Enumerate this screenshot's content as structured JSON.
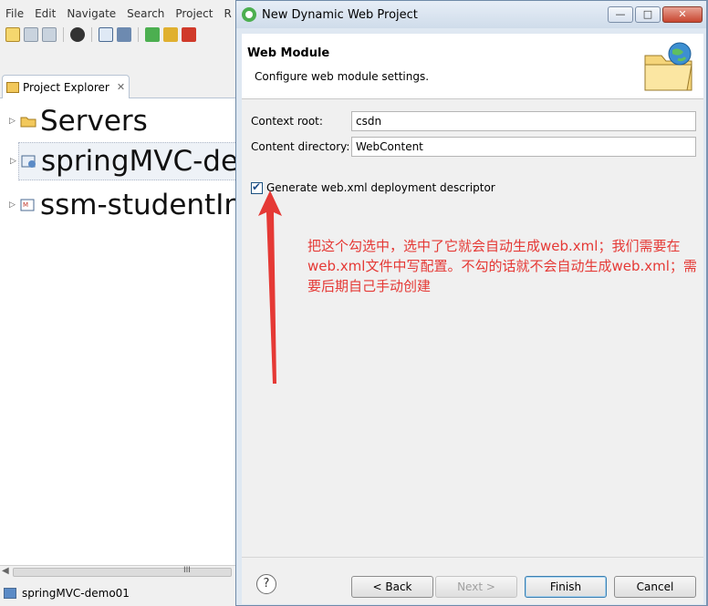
{
  "eclipse": {
    "menu": [
      "File",
      "Edit",
      "Navigate",
      "Search",
      "Project",
      "R"
    ],
    "project_explorer": {
      "tab_label": "Project Explorer",
      "close_glyph": "✕",
      "items": [
        {
          "label": "Servers",
          "icon": "folder-icon",
          "selected": false
        },
        {
          "label": "springMVC-de",
          "icon": "web-project-icon",
          "selected": true
        },
        {
          "label": "ssm-studentIn",
          "icon": "maven-project-icon",
          "selected": false
        }
      ]
    },
    "scrollbar_glyph": "III",
    "status": {
      "text": "springMVC-demo01"
    }
  },
  "dialog": {
    "title": "New Dynamic Web Project",
    "window_buttons": {
      "minimize": "—",
      "maximize": "□",
      "close": "✕"
    },
    "header": {
      "title": "Web Module",
      "description": "Configure web module settings."
    },
    "fields": [
      {
        "label": "Context root:",
        "value": "csdn"
      },
      {
        "label": "Content directory:",
        "value": "WebContent"
      }
    ],
    "checkbox": {
      "label": "Generate web.xml deployment descriptor",
      "checked": true
    },
    "annotation": "把这个勾选中，选中了它就会自动生成web.xml；我们需要在web.xml文件中写配置。不勾的话就不会自动生成web.xml；需要后期自己手动创建",
    "buttons": {
      "help": "?",
      "back": "< Back",
      "next": "Next >",
      "finish": "Finish",
      "cancel": "Cancel"
    },
    "colors": {
      "annotation": "#e53935",
      "accent": "#3c7fb1"
    }
  }
}
